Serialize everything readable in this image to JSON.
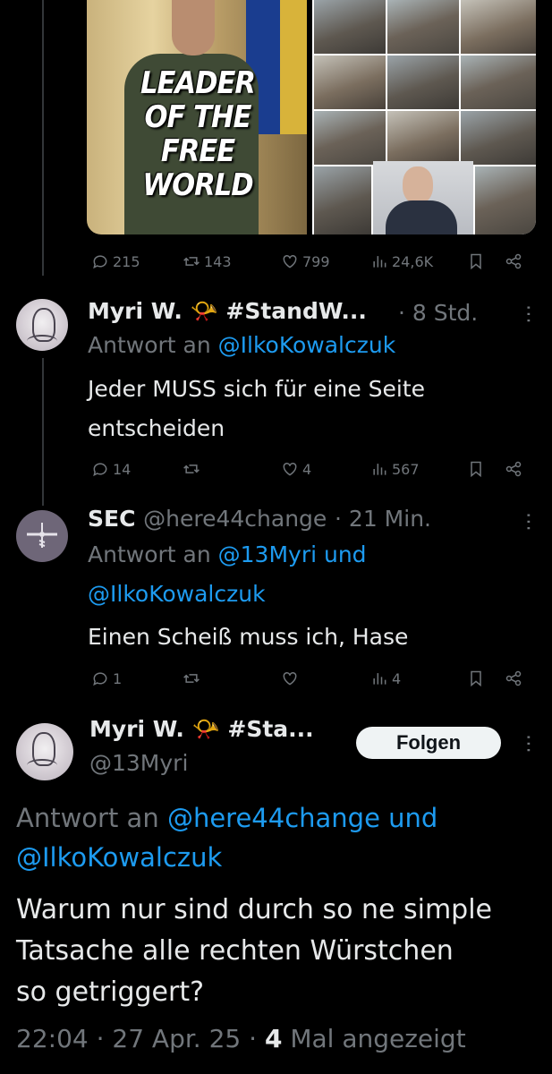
{
  "media": {
    "left_caption_lines": [
      "LEADER",
      "OF THE",
      "FREE WORLD"
    ]
  },
  "tweet0": {
    "replies": "215",
    "retweets": "143",
    "likes": "799",
    "views": "24,6K"
  },
  "tweet1": {
    "name": "Myri W.",
    "name_suffix": "#StandW...",
    "time": "· 8 Std.",
    "reply_prefix": "Antwort an",
    "reply_handles": "@IlkoKowalczuk",
    "text_lines": [
      "Jeder MUSS sich für eine Seite",
      "entscheiden"
    ],
    "replies": "14",
    "retweets": "",
    "likes": "4",
    "views": "567"
  },
  "tweet2": {
    "name": "SEC",
    "handle": "@here44change",
    "time": "· 21 Min.",
    "reply_prefix": "Antwort an",
    "reply_handles_line1": "@13Myri und",
    "reply_handles_line2": "@IlkoKowalczuk",
    "text": "Einen Scheiß muss ich, Hase",
    "replies": "1",
    "retweets": "",
    "likes": "",
    "views": "4"
  },
  "main_tweet": {
    "name": "Myri W.",
    "name_suffix": "#Sta...",
    "handle": "@13Myri",
    "follow_label": "Folgen",
    "reply_prefix": "Antwort an",
    "reply_handles_line1": "@here44change und",
    "reply_handles_line2": "@IlkoKowalczuk",
    "text_lines": [
      "Warum nur sind durch so ne simple",
      "Tatsache alle rechten Würstchen",
      "so getriggert?"
    ],
    "timestamp": "22:04 · 27 Apr. 25 ·",
    "views_count": "4",
    "views_label": "Mal angezeigt"
  },
  "icons": {
    "reply": "reply-bubble-icon",
    "retweet": "retweet-icon",
    "like": "heart-icon",
    "views": "views-bar-chart-icon",
    "bookmark": "bookmark-icon",
    "share": "share-icon",
    "more": "more-dots-icon",
    "badge": "posthorn-emoji"
  }
}
